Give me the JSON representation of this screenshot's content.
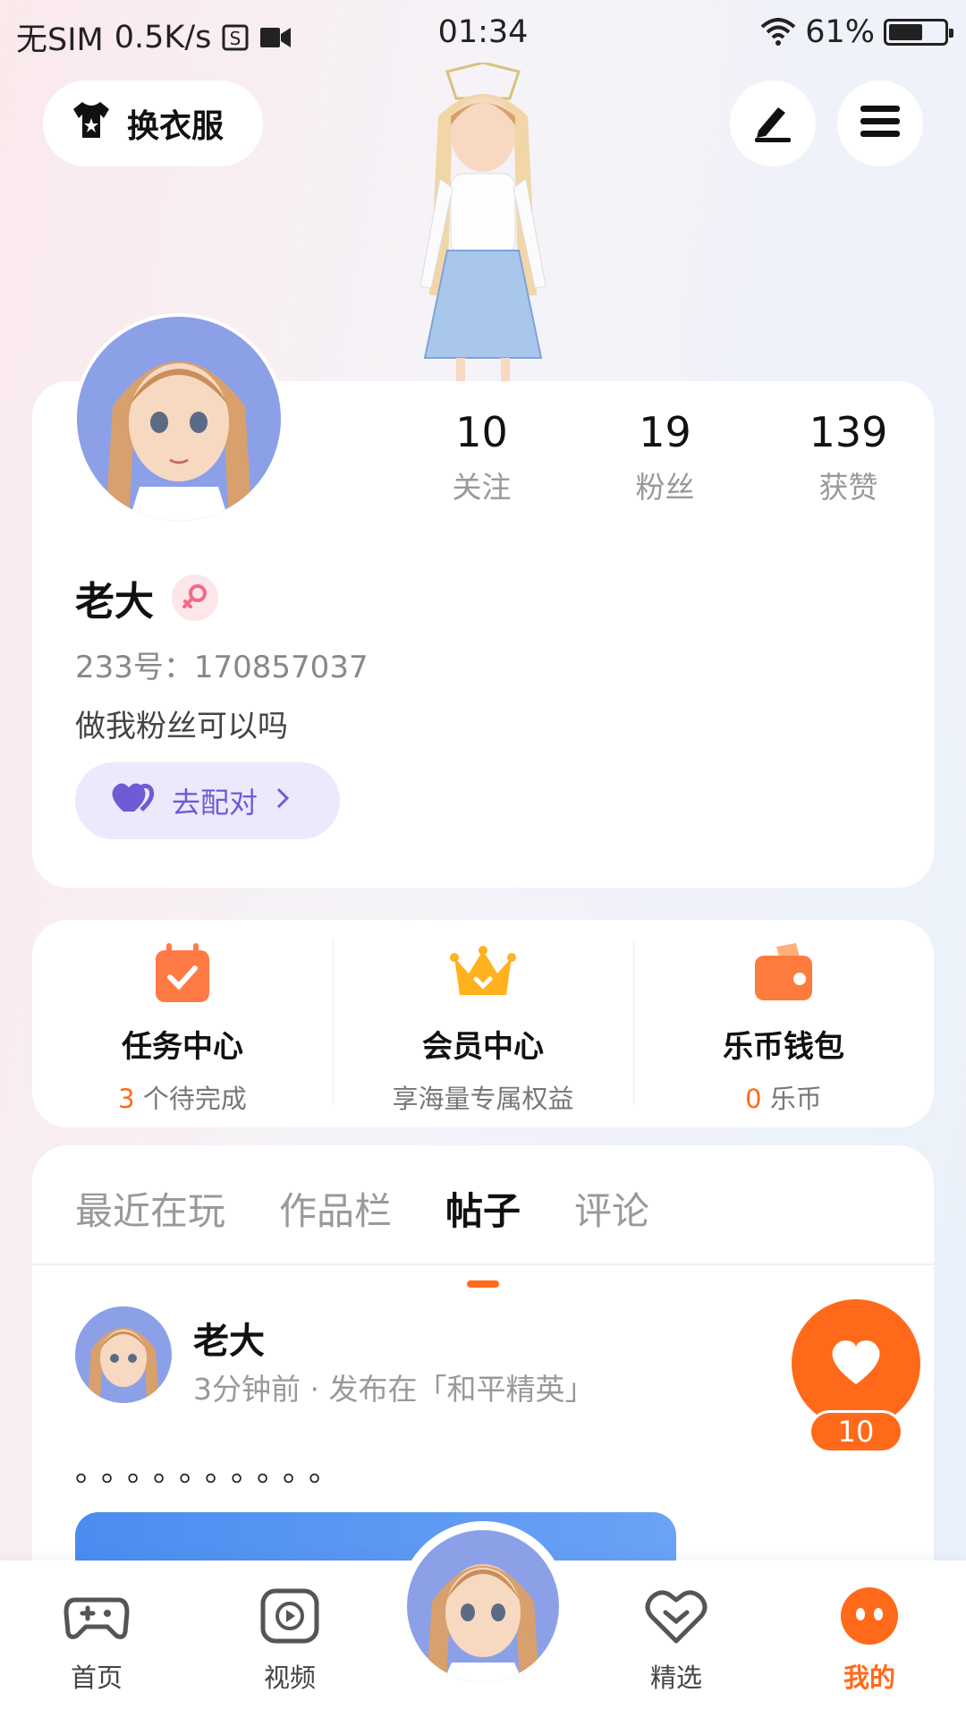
{
  "status_bar": {
    "carrier": "无SIM",
    "speed": "0.5K/s",
    "time": "01:34",
    "battery": "61%",
    "battery_level": 0.61
  },
  "header": {
    "dress_label": "换衣服",
    "edit_icon": "pen-icon",
    "menu_icon": "hamburger-menu-icon"
  },
  "profile": {
    "stats": [
      {
        "value": "10",
        "label": "关注"
      },
      {
        "value": "19",
        "label": "粉丝"
      },
      {
        "value": "139",
        "label": "获赞"
      }
    ],
    "name": "老大",
    "gender": "female",
    "uid": "233号：170857037",
    "bio": "做我粉丝可以吗",
    "pair_label": "去配对"
  },
  "quick": [
    {
      "title": "任务中心",
      "highlight": "3",
      "sub": " 个待完成",
      "icon": "calendar-check-icon"
    },
    {
      "title": "会员中心",
      "highlight": "",
      "sub": "享海量专属权益",
      "icon": "crown-icon"
    },
    {
      "title": "乐币钱包",
      "highlight": "0",
      "sub": " 乐币",
      "icon": "wallet-icon"
    }
  ],
  "tabs": [
    "最近在玩",
    "作品栏",
    "帖子",
    "评论"
  ],
  "active_tab": "帖子",
  "post": {
    "author": "老大",
    "meta": "3分钟前 · 发布在「和平精英」",
    "text": "。。。。。。。。。。",
    "likes": "10"
  },
  "nav": {
    "items": [
      {
        "label": "首页",
        "icon": "gamepad-icon"
      },
      {
        "label": "视频",
        "icon": "play-icon"
      },
      {
        "label": "精选",
        "icon": "heart-icon"
      },
      {
        "label": "我的",
        "icon": "face-icon"
      }
    ],
    "active": "我的"
  },
  "colors": {
    "accent": "#ff6a1a",
    "pair": "#6e5bd6"
  }
}
